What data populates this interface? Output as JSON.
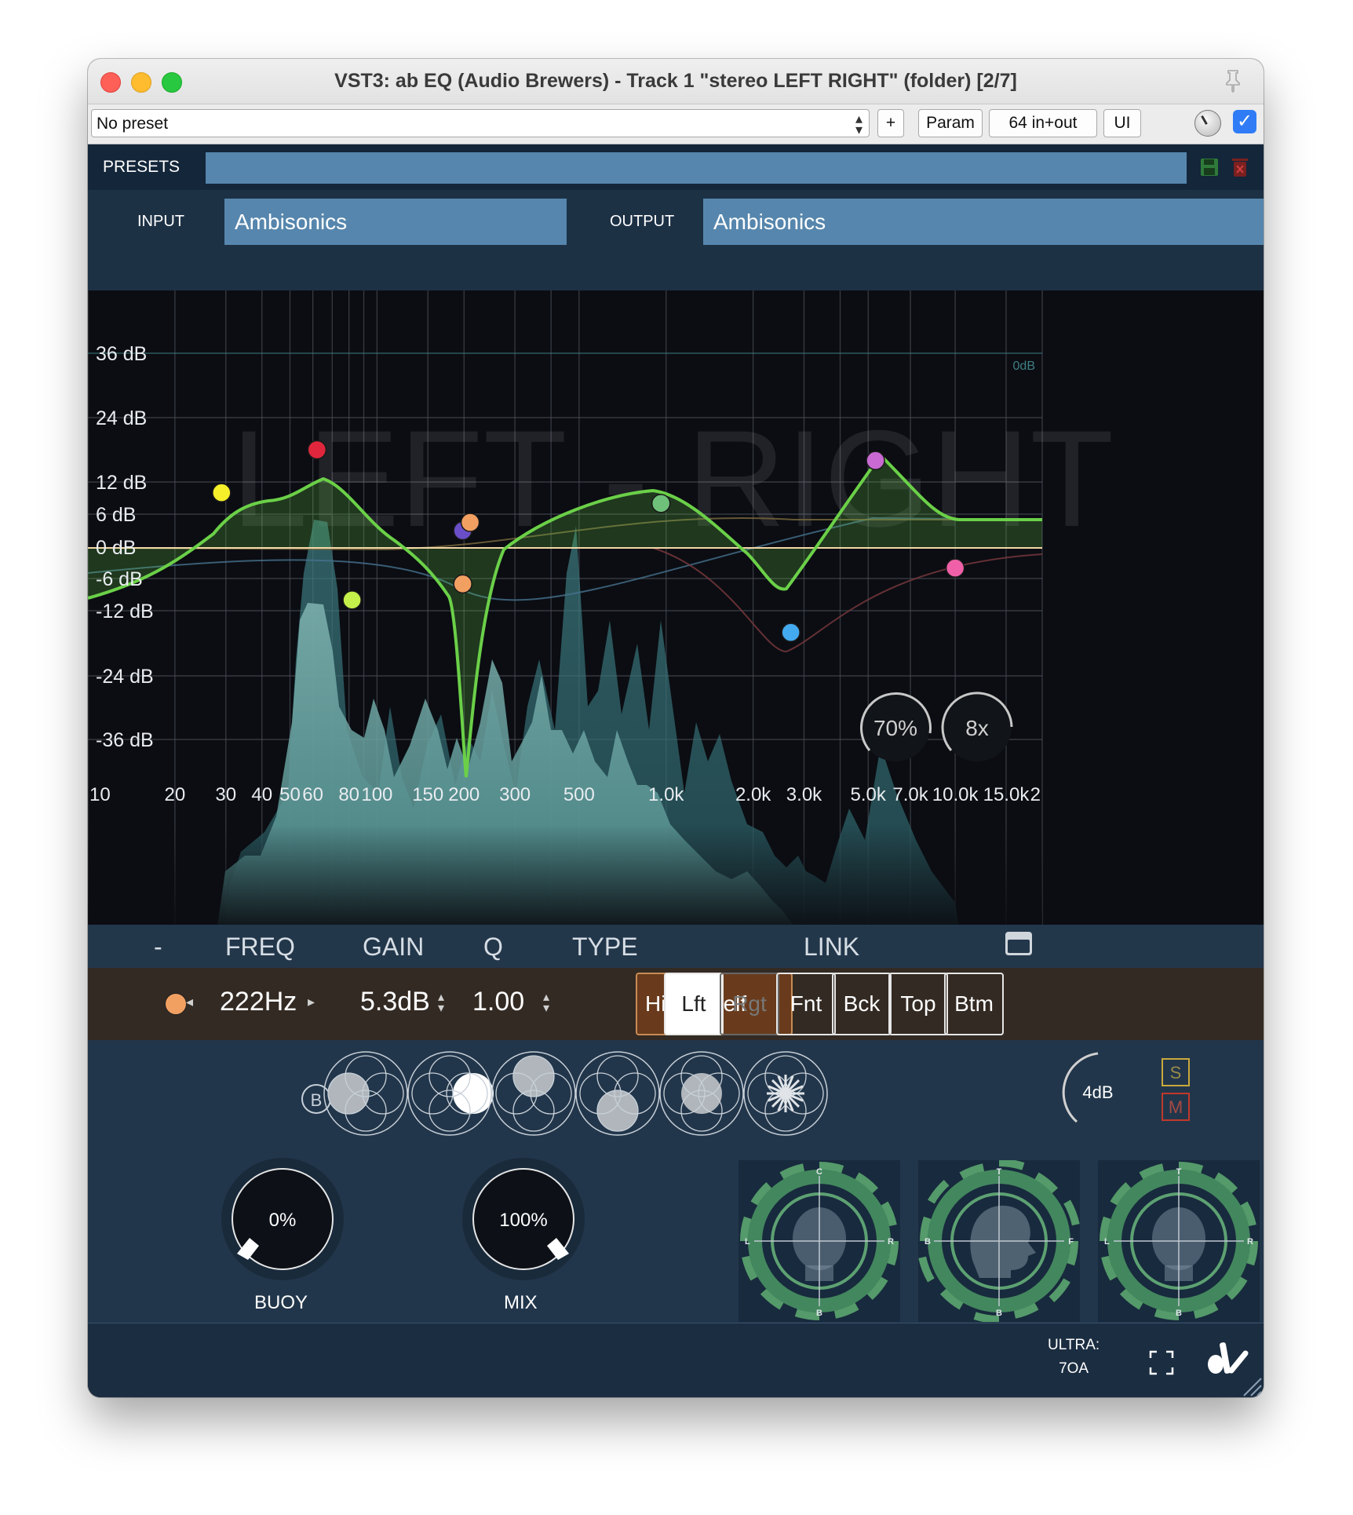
{
  "window": {
    "title": "VST3: ab EQ (Audio Brewers) - Track 1 \"stereo LEFT RIGHT\" (folder) [2/7]"
  },
  "host_toolbar": {
    "preset_select": "No preset",
    "add_label": "+",
    "param_label": "Param",
    "io_label": "64 in+out",
    "ui_label": "UI",
    "enabled_checked": true
  },
  "presets": {
    "label": "PRESETS",
    "value": ""
  },
  "io": {
    "input_label": "INPUT",
    "input_value": "Ambisonics",
    "output_label": "OUTPUT",
    "output_value": "Ambisonics"
  },
  "graph": {
    "watermark": "LEFT - RIGHT",
    "zero_db_tag": "0dB",
    "db_labels": [
      {
        "text": "36 dB",
        "db": 36
      },
      {
        "text": "24 dB",
        "db": 24
      },
      {
        "text": "12 dB",
        "db": 12
      },
      {
        "text": "6 dB",
        "db": 6
      },
      {
        "text": "0 dB",
        "db": 0
      },
      {
        "text": "-6 dB",
        "db": -6
      },
      {
        "text": "-12 dB",
        "db": -12
      },
      {
        "text": "-24 dB",
        "db": -24
      },
      {
        "text": "-36 dB",
        "db": -36
      }
    ],
    "freq_labels": [
      {
        "text": "10",
        "hz": 10
      },
      {
        "text": "20",
        "hz": 20
      },
      {
        "text": "30",
        "hz": 30
      },
      {
        "text": "40",
        "hz": 40
      },
      {
        "text": "50",
        "hz": 50
      },
      {
        "text": "60",
        "hz": 60
      },
      {
        "text": "80",
        "hz": 80
      },
      {
        "text": "100",
        "hz": 100
      },
      {
        "text": "150",
        "hz": 150
      },
      {
        "text": "200",
        "hz": 200
      },
      {
        "text": "300",
        "hz": 300
      },
      {
        "text": "500",
        "hz": 500
      },
      {
        "text": "1.0k",
        "hz": 1000
      },
      {
        "text": "2.0k",
        "hz": 2000
      },
      {
        "text": "3.0k",
        "hz": 3000
      },
      {
        "text": "5.0k",
        "hz": 5000
      },
      {
        "text": "7.0k",
        "hz": 7000
      },
      {
        "text": "10.0k",
        "hz": 10000
      },
      {
        "text": "15.0k",
        "hz": 15000
      },
      {
        "text": "2",
        "hz": 20000
      }
    ],
    "band_nodes": [
      {
        "name": "band-node-yellow",
        "color": "#f5f02a",
        "hz": 29,
        "db": 10
      },
      {
        "name": "band-node-red",
        "color": "#e0263c",
        "hz": 62,
        "db": 18
      },
      {
        "name": "band-node-lime",
        "color": "#c6f04a",
        "hz": 82,
        "db": -10
      },
      {
        "name": "band-node-purple",
        "color": "#6a4ec8",
        "hz": 198,
        "db": 3
      },
      {
        "name": "band-node-orange-q",
        "color": "#f2a062",
        "hz": 198,
        "db": -7
      },
      {
        "name": "band-node-orange",
        "color": "#f2a062",
        "hz": 210,
        "db": 4.5
      },
      {
        "name": "band-node-green",
        "color": "#6fc07a",
        "hz": 960,
        "db": 8
      },
      {
        "name": "band-node-blue",
        "color": "#44aaf0",
        "hz": 2700,
        "db": -16
      },
      {
        "name": "band-node-violet",
        "color": "#c86ad2",
        "hz": 5300,
        "db": 16
      },
      {
        "name": "band-node-pink",
        "color": "#f060a8",
        "hz": 10000,
        "db": -4
      }
    ],
    "range_knob": "70%",
    "zoom_knob": "8x"
  },
  "band_editor": {
    "col_dash": "-",
    "col_freq": "FREQ",
    "col_gain": "GAIN",
    "col_q": "Q",
    "col_type": "TYPE",
    "col_link": "LINK",
    "freq": "222Hz",
    "gain": "5.3dB",
    "q": "1.00",
    "type": "High Shelf",
    "links": [
      {
        "label": "Lft",
        "state": "active"
      },
      {
        "label": "Rgt",
        "state": "disabled"
      },
      {
        "label": "Fnt",
        "state": "normal"
      },
      {
        "label": "Bck",
        "state": "normal"
      },
      {
        "label": "Top",
        "state": "normal"
      },
      {
        "label": "Btm",
        "state": "normal"
      }
    ]
  },
  "lower": {
    "bypass_label": "B",
    "output_gain": "4dB",
    "solo_label": "S",
    "mute_label": "M",
    "buoy": {
      "label": "BUOY",
      "value": "0%"
    },
    "mix": {
      "label": "MIX",
      "value": "100%"
    },
    "viz_labels": {
      "top_c": "C",
      "bottom_b": "B",
      "left_l": "L",
      "right_r": "R",
      "top_t": "T",
      "left_b": "B",
      "right_f": "F"
    }
  },
  "footer": {
    "ultra_line1": "ULTRA:",
    "ultra_line2": "7OA"
  },
  "colors": {
    "accent_blue": "#5686ad",
    "curve_green": "#6bd048",
    "type_brown": "#693b1c"
  }
}
